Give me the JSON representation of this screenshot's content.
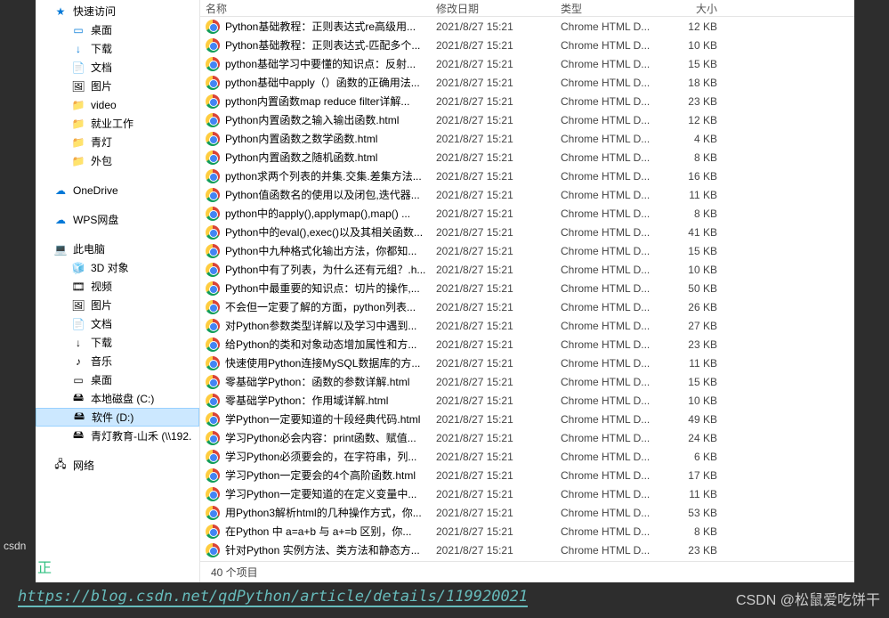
{
  "headers": {
    "name": "名称",
    "date": "修改日期",
    "type": "类型",
    "size": "大小"
  },
  "sidebar": {
    "quick": [
      {
        "label": "快速访问",
        "icon": "★",
        "cls": "star-icon"
      },
      {
        "label": "桌面",
        "icon": "▭",
        "cls": "blue-icon"
      },
      {
        "label": "下载",
        "icon": "↓",
        "cls": "blue-icon"
      },
      {
        "label": "文档",
        "icon": "📄",
        "cls": ""
      },
      {
        "label": "图片",
        "icon": "🖼",
        "cls": ""
      },
      {
        "label": "video",
        "icon": "📁",
        "cls": "folder-icon"
      },
      {
        "label": "就业工作",
        "icon": "📁",
        "cls": "folder-icon"
      },
      {
        "label": "青灯",
        "icon": "📁",
        "cls": "folder-icon"
      },
      {
        "label": "外包",
        "icon": "📁",
        "cls": "folder-icon"
      }
    ],
    "clouds": [
      {
        "label": "OneDrive",
        "icon": "☁",
        "cls": "blue-icon"
      },
      {
        "label": "WPS网盘",
        "icon": "☁",
        "cls": "blue-icon"
      }
    ],
    "thispc": {
      "label": "此电脑",
      "icon": "💻"
    },
    "pcitems": [
      {
        "label": "3D 对象",
        "icon": "🧊"
      },
      {
        "label": "视频",
        "icon": "🎞"
      },
      {
        "label": "图片",
        "icon": "🖼"
      },
      {
        "label": "文档",
        "icon": "📄"
      },
      {
        "label": "下载",
        "icon": "↓"
      },
      {
        "label": "音乐",
        "icon": "♪"
      },
      {
        "label": "桌面",
        "icon": "▭"
      },
      {
        "label": "本地磁盘 (C:)",
        "icon": "🖴"
      },
      {
        "label": "软件 (D:)",
        "icon": "🖴",
        "selected": true
      },
      {
        "label": "青灯教育-山禾 (\\\\192.",
        "icon": "🖴"
      }
    ],
    "network": {
      "label": "网络",
      "icon": "🖧"
    }
  },
  "files": [
    {
      "name": "Python基础教程：正则表达式re高级用...",
      "date": "2021/8/27 15:21",
      "type": "Chrome HTML D...",
      "size": "12 KB"
    },
    {
      "name": "Python基础教程：正则表达式-匹配多个...",
      "date": "2021/8/27 15:21",
      "type": "Chrome HTML D...",
      "size": "10 KB"
    },
    {
      "name": "python基础学习中要懂的知识点：反射...",
      "date": "2021/8/27 15:21",
      "type": "Chrome HTML D...",
      "size": "15 KB"
    },
    {
      "name": "python基础中apply（）函数的正确用法...",
      "date": "2021/8/27 15:21",
      "type": "Chrome HTML D...",
      "size": "18 KB"
    },
    {
      "name": "python内置函数map reduce filter详解...",
      "date": "2021/8/27 15:21",
      "type": "Chrome HTML D...",
      "size": "23 KB"
    },
    {
      "name": "Python内置函数之输入输出函数.html",
      "date": "2021/8/27 15:21",
      "type": "Chrome HTML D...",
      "size": "12 KB"
    },
    {
      "name": "Python内置函数之数学函数.html",
      "date": "2021/8/27 15:21",
      "type": "Chrome HTML D...",
      "size": "4 KB"
    },
    {
      "name": "Python内置函数之随机函数.html",
      "date": "2021/8/27 15:21",
      "type": "Chrome HTML D...",
      "size": "8 KB"
    },
    {
      "name": "python求两个列表的并集.交集.差集方法...",
      "date": "2021/8/27 15:21",
      "type": "Chrome HTML D...",
      "size": "16 KB"
    },
    {
      "name": "Python值函数名的使用以及闭包,迭代器...",
      "date": "2021/8/27 15:21",
      "type": "Chrome HTML D...",
      "size": "11 KB"
    },
    {
      "name": "python中的apply(),applymap(),map() ...",
      "date": "2021/8/27 15:21",
      "type": "Chrome HTML D...",
      "size": "8 KB"
    },
    {
      "name": "Python中的eval(),exec()以及其相关函数...",
      "date": "2021/8/27 15:21",
      "type": "Chrome HTML D...",
      "size": "41 KB"
    },
    {
      "name": "Python中九种格式化输出方法，你都知...",
      "date": "2021/8/27 15:21",
      "type": "Chrome HTML D...",
      "size": "15 KB"
    },
    {
      "name": "Python中有了列表，为什么还有元组？.h...",
      "date": "2021/8/27 15:21",
      "type": "Chrome HTML D...",
      "size": "10 KB"
    },
    {
      "name": "Python中最重要的知识点：切片的操作,...",
      "date": "2021/8/27 15:21",
      "type": "Chrome HTML D...",
      "size": "50 KB"
    },
    {
      "name": "不会但一定要了解的方面，python列表...",
      "date": "2021/8/27 15:21",
      "type": "Chrome HTML D...",
      "size": "26 KB"
    },
    {
      "name": "对Python参数类型详解以及学习中遇到...",
      "date": "2021/8/27 15:21",
      "type": "Chrome HTML D...",
      "size": "27 KB"
    },
    {
      "name": "给Python的类和对象动态增加属性和方...",
      "date": "2021/8/27 15:21",
      "type": "Chrome HTML D...",
      "size": "23 KB"
    },
    {
      "name": "快速使用Python连接MySQL数据库的方...",
      "date": "2021/8/27 15:21",
      "type": "Chrome HTML D...",
      "size": "11 KB"
    },
    {
      "name": "零基础学Python：函数的参数详解.html",
      "date": "2021/8/27 15:21",
      "type": "Chrome HTML D...",
      "size": "15 KB"
    },
    {
      "name": "零基础学Python：作用域详解.html",
      "date": "2021/8/27 15:21",
      "type": "Chrome HTML D...",
      "size": "10 KB"
    },
    {
      "name": "学Python一定要知道的十段经典代码.html",
      "date": "2021/8/27 15:21",
      "type": "Chrome HTML D...",
      "size": "49 KB"
    },
    {
      "name": "学习Python必会内容：print函数、赋值...",
      "date": "2021/8/27 15:21",
      "type": "Chrome HTML D...",
      "size": "24 KB"
    },
    {
      "name": "学习Python必须要会的，在字符串，列...",
      "date": "2021/8/27 15:21",
      "type": "Chrome HTML D...",
      "size": "6 KB"
    },
    {
      "name": "学习Python一定要会的4个高阶函数.html",
      "date": "2021/8/27 15:21",
      "type": "Chrome HTML D...",
      "size": "17 KB"
    },
    {
      "name": "学习Python一定要知道的在定义变量中...",
      "date": "2021/8/27 15:21",
      "type": "Chrome HTML D...",
      "size": "11 KB"
    },
    {
      "name": "用Python3解析html的几种操作方式，你...",
      "date": "2021/8/27 15:21",
      "type": "Chrome HTML D...",
      "size": "53 KB"
    },
    {
      "name": "在Python 中 a=a+b 与 a+=b 区别，你...",
      "date": "2021/8/27 15:21",
      "type": "Chrome HTML D...",
      "size": "8 KB"
    },
    {
      "name": "针对Python 实例方法、类方法和静态方...",
      "date": "2021/8/27 15:21",
      "type": "Chrome HTML D...",
      "size": "23 KB"
    }
  ],
  "status": "40 个项目",
  "taskbar": "csdn",
  "url": "https://blog.csdn.net/qdPython/article/details/119920021",
  "watermark": "CSDN @松鼠爱吃饼干",
  "osbg": "正"
}
